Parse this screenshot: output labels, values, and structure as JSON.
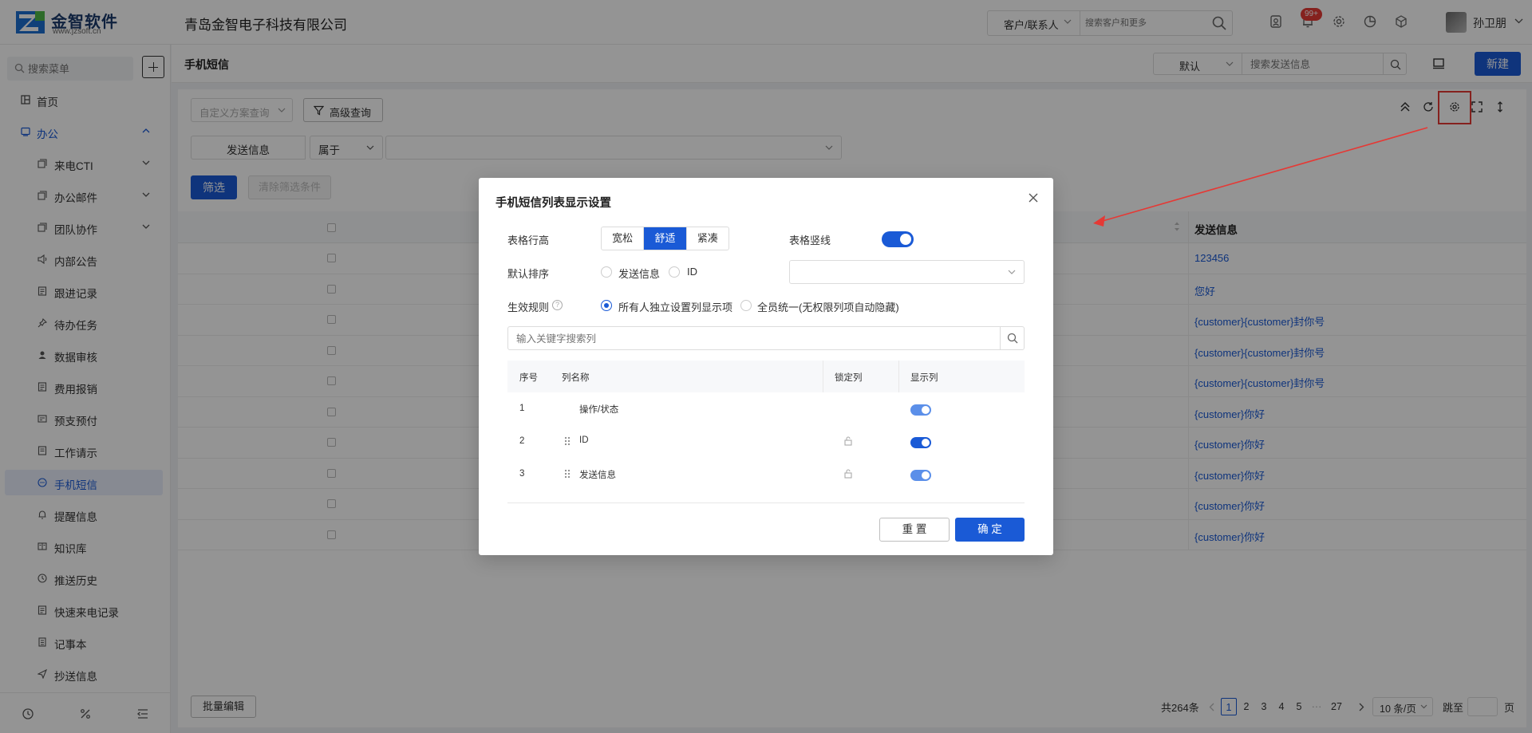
{
  "app": {
    "logo_name": "金智软件",
    "logo_sub": "www.jzsoft.cn",
    "company": "青岛金智电子科技有限公司"
  },
  "topbar": {
    "search_scope": "客户/联系人",
    "search_placeholder": "搜索客户和更多",
    "notification_badge": "99+",
    "user_name": "孙卫朋"
  },
  "sidebar": {
    "search_placeholder": "搜索菜单",
    "items": [
      {
        "label": "首页",
        "icon": "home-grid-icon"
      },
      {
        "label": "办公",
        "icon": "office-icon"
      },
      {
        "label": "来电CTI",
        "icon": "copy-icon"
      },
      {
        "label": "办公邮件",
        "icon": "copy-icon"
      },
      {
        "label": "团队协作",
        "icon": "copy-icon"
      },
      {
        "label": "内部公告",
        "icon": "speaker-icon"
      },
      {
        "label": "跟进记录",
        "icon": "doc-icon"
      },
      {
        "label": "待办任务",
        "icon": "pin-icon"
      },
      {
        "label": "数据审核",
        "icon": "user-icon"
      },
      {
        "label": "费用报销",
        "icon": "doc-icon"
      },
      {
        "label": "预支预付",
        "icon": "card-icon"
      },
      {
        "label": "工作请示",
        "icon": "doc-icon"
      },
      {
        "label": "手机短信",
        "icon": "chat-icon"
      },
      {
        "label": "提醒信息",
        "icon": "bell-icon"
      },
      {
        "label": "知识库",
        "icon": "book-icon"
      },
      {
        "label": "推送历史",
        "icon": "clock-icon"
      },
      {
        "label": "快速来电记录",
        "icon": "doc-icon"
      },
      {
        "label": "记事本",
        "icon": "notebook-icon"
      },
      {
        "label": "抄送信息",
        "icon": "send-icon"
      }
    ]
  },
  "content": {
    "page_title": "手机短信",
    "view_select": "默认",
    "search_placeholder": "搜索发送信息",
    "new_button": "新建",
    "custom_query_placeholder": "自定义方案查询",
    "advanced_query": "高级查询",
    "filter_field": "发送信息",
    "filter_operator": "属于",
    "filter_button": "筛选",
    "clear_button": "清除筛选条件"
  },
  "table": {
    "column_send": "发送信息",
    "rows": [
      "123456",
      "您好",
      "{customer}{customer}封你号",
      "{customer}{customer}封你号",
      "{customer}{customer}封你号",
      "{customer}你好",
      "{customer}你好",
      "{customer}你好",
      "{customer}你好",
      "{customer}你好"
    ]
  },
  "footer": {
    "batch_edit": "批量编辑",
    "total": "共264条",
    "pages": [
      "1",
      "2",
      "3",
      "4",
      "5"
    ],
    "ellipsis": "···",
    "last_page": "27",
    "page_size": "10 条/页",
    "goto_label": "跳至",
    "page_suffix": "页"
  },
  "modal": {
    "title": "手机短信列表显示设置",
    "row_height_label": "表格行高",
    "row_height_options": [
      "宽松",
      "舒适",
      "紧凑"
    ],
    "row_height_selected": "舒适",
    "vertical_lines_label": "表格竖线",
    "default_sort_label": "默认排序",
    "sort_options": [
      "发送信息",
      "ID"
    ],
    "rule_label": "生效规则",
    "rule_options": [
      "所有人独立设置列显示项",
      "全员统一(无权限列项自动隐藏)"
    ],
    "col_search_placeholder": "输入关键字搜索列",
    "col_headers": {
      "no": "序号",
      "name": "列名称",
      "lock": "锁定列",
      "show": "显示列"
    },
    "columns": [
      {
        "no": "1",
        "name": "操作/状态",
        "visible": true
      },
      {
        "no": "2",
        "name": "ID",
        "visible": true
      },
      {
        "no": "3",
        "name": "发送信息",
        "visible": true
      }
    ],
    "reset_button": "重 置",
    "ok_button": "确 定"
  },
  "colors": {
    "primary": "#1a5ad6",
    "highlight": "#e53935"
  }
}
